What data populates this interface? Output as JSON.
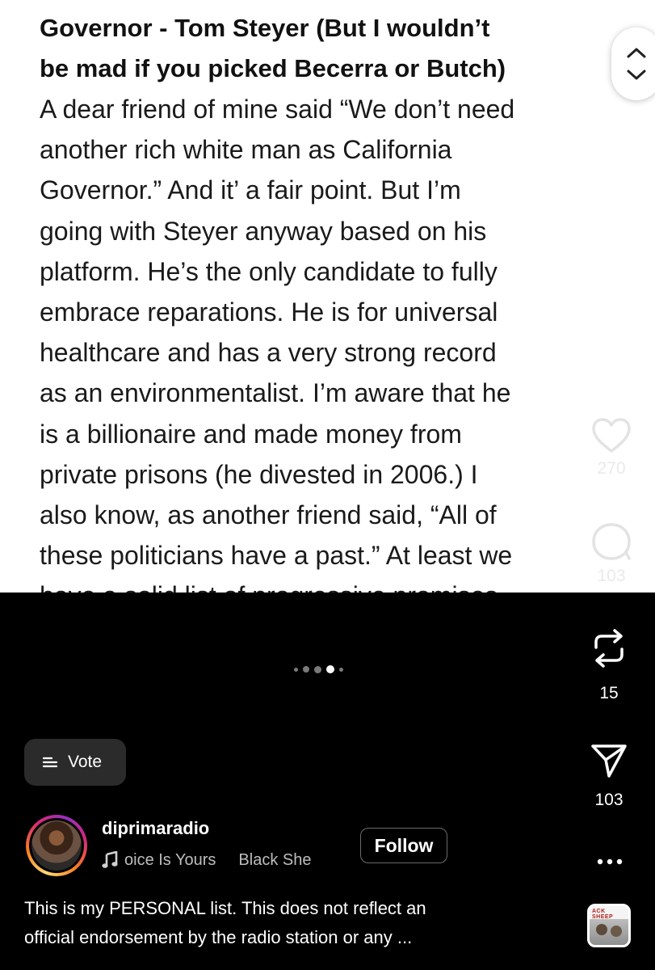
{
  "slide": {
    "heading": [
      "Governor - Tom Steyer (But I wouldn’t",
      "be mad if you picked Becerra or Butch)"
    ],
    "body": [
      "A dear friend of mine said “We don’t need",
      "another rich white man as California",
      "Governor.” And it’ a fair point. But I’m",
      "going with Steyer anyway based on his",
      "platform. He’s the only candidate to fully",
      "embrace reparations. He is for universal",
      "healthcare and has a very strong record",
      "as an  environmentalist. I’m aware that he",
      "is a billionaire and made money from",
      "private prisons (he divested in 2006.) I",
      "also know, as another friend said, “All of",
      "these politicians have a past.” At least we",
      "have a solid list of progressive promises"
    ]
  },
  "actions": {
    "likes": "270",
    "comments": "103",
    "reposts": "15",
    "shares": "103"
  },
  "carousel": {
    "total": 5,
    "active": 4
  },
  "vote": {
    "label": "Vote"
  },
  "author": {
    "username": "diprimaradio",
    "audio": [
      "oice Is Yours",
      "Black She"
    ],
    "follow_label": "Follow"
  },
  "caption": {
    "lines": [
      "This is my PERSONAL list. This does not reflect an",
      "official endorsement by the radio station or any ..."
    ]
  },
  "thumbnail": {
    "text": "ACK SHEEP"
  },
  "colors": {
    "background": "#000000",
    "slide_bg": "#ffffff",
    "active_dot": "#ffffff",
    "inactive_dot": "#7a7a7a"
  }
}
